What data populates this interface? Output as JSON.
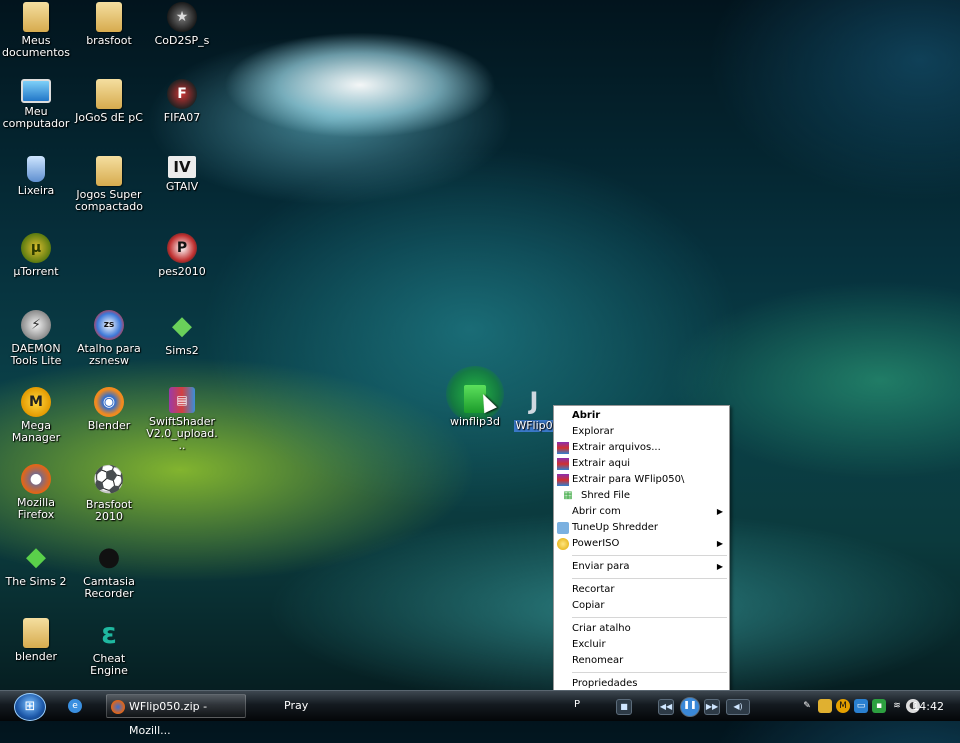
{
  "desktop": {
    "icons": [
      {
        "label": "Meus documentos",
        "icon": "documents-folder-icon"
      },
      {
        "label": "brasfoot",
        "icon": "folder-icon"
      },
      {
        "label": "CoD2SP_s",
        "icon": "game-icon"
      },
      {
        "label": "Meu computador",
        "icon": "computer-icon"
      },
      {
        "label": "JoGoS dE pC",
        "icon": "folder-icon"
      },
      {
        "label": "FIFA07",
        "icon": "game-icon"
      },
      {
        "label": "Lixeira",
        "icon": "recycle-bin-icon"
      },
      {
        "label": "Jogos Super compactado",
        "icon": "folder-icon"
      },
      {
        "label": "GTAIV",
        "icon": "game-icon"
      },
      {
        "label": "µTorrent",
        "icon": "utorrent-icon"
      },
      {
        "label": "pes2010",
        "icon": "game-icon"
      },
      {
        "label": "DAEMON Tools Lite",
        "icon": "daemon-tools-icon"
      },
      {
        "label": "Atalho para zsnesw",
        "icon": "zsnes-icon"
      },
      {
        "label": "Sims2",
        "icon": "sims-icon"
      },
      {
        "label": "Mega Manager",
        "icon": "mega-manager-icon"
      },
      {
        "label": "Blender",
        "icon": "blender-icon"
      },
      {
        "label": "SwiftShader V2.0_upload...",
        "icon": "archive-icon"
      },
      {
        "label": "Mozilla Firefox",
        "icon": "firefox-icon"
      },
      {
        "label": "Brasfoot 2010",
        "icon": "soccer-ball-icon"
      },
      {
        "label": "The Sims 2",
        "icon": "sims-icon"
      },
      {
        "label": "Camtasia Recorder",
        "icon": "camtasia-icon"
      },
      {
        "label": "blender",
        "icon": "folder-icon"
      },
      {
        "label": "Cheat Engine",
        "icon": "cheat-engine-icon"
      },
      {
        "label": "winflip3d",
        "icon": "winflip-icon"
      },
      {
        "label": "WFlip0",
        "icon": "wflip-icon"
      }
    ]
  },
  "context_menu": {
    "items": [
      {
        "label": "Abrir"
      },
      {
        "label": "Explorar"
      },
      {
        "label": "Extrair arquivos..."
      },
      {
        "label": "Extrair aqui"
      },
      {
        "label": "Extrair para WFlip050\\"
      },
      {
        "label": "Shred File"
      },
      {
        "label": "Abrir com"
      },
      {
        "label": "TuneUp Shredder"
      },
      {
        "label": "PowerISO"
      },
      {
        "label": "Enviar para"
      },
      {
        "label": "Recortar"
      },
      {
        "label": "Copiar"
      },
      {
        "label": "Criar atalho"
      },
      {
        "label": "Excluir"
      },
      {
        "label": "Renomear"
      },
      {
        "label": "Propriedades"
      }
    ]
  },
  "taskbar": {
    "tasks": [
      {
        "label": "WFlip050.zip - Mozill..."
      },
      {
        "label": "Pray"
      }
    ],
    "media_label": "P",
    "clock": "14:42"
  }
}
